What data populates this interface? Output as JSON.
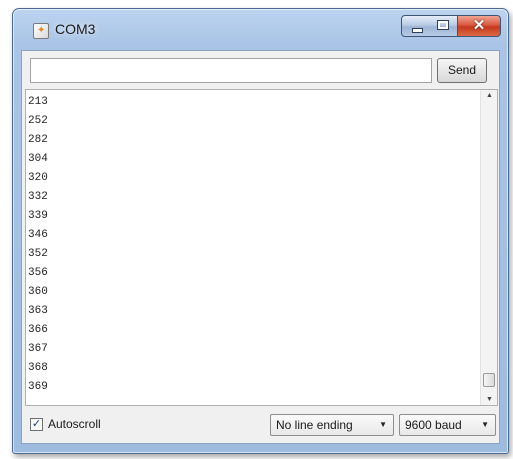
{
  "window": {
    "title": "COM3",
    "close_glyph": "✕"
  },
  "toolbar": {
    "input_value": "",
    "send_label": "Send"
  },
  "output": {
    "lines": [
      "213",
      "252",
      "282",
      "304",
      "320",
      "332",
      "339",
      "346",
      "352",
      "356",
      "360",
      "363",
      "366",
      "367",
      "368",
      "369"
    ]
  },
  "footer": {
    "autoscroll_label": "Autoscroll",
    "autoscroll_checked": true,
    "line_ending": {
      "selected": "No line ending"
    },
    "baud_rate": {
      "selected": "9600 baud"
    }
  },
  "icons": {
    "app": "arduino-app-icon",
    "minimize": "minimize-icon",
    "maximize": "maximize-icon",
    "close": "close-icon",
    "check": "checkmark-icon",
    "dropdown": "chevron-down-icon",
    "scroll_up": "scroll-up-icon",
    "scroll_down": "scroll-down-icon"
  },
  "colors": {
    "titlebar": "#a9c4e6",
    "close_button": "#c6381e",
    "client_background": "#f0f0f0"
  }
}
